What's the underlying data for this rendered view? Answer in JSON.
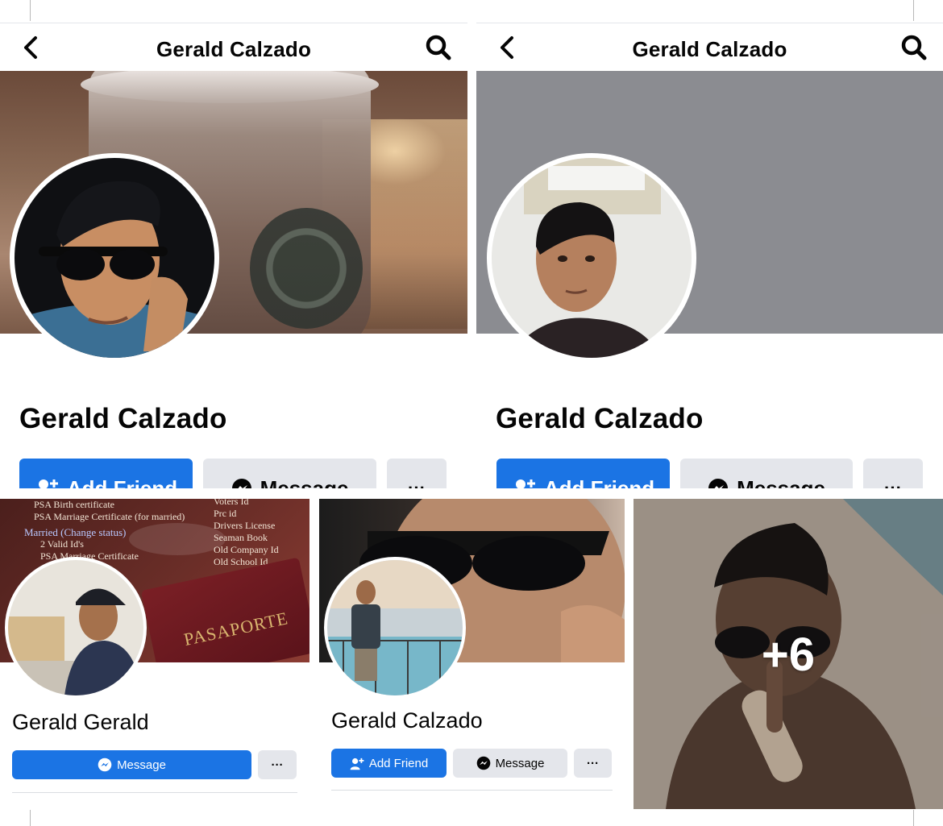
{
  "top_left": {
    "nav_title": "Gerald Calzado",
    "profile_name": "Gerald Calzado",
    "add_friend_label": "Add Friend",
    "message_label": "Message",
    "more_label": "···"
  },
  "top_right": {
    "nav_title": "Gerald Calzado",
    "profile_name": "Gerald Calzado",
    "add_friend_label": "Add Friend",
    "message_label": "Message",
    "more_label": "···"
  },
  "card_1": {
    "cover_text": {
      "col1": [
        "PSA Birth certificate",
        "PSA Marriage Certificate (for married)",
        "Married (Change status)",
        "2 Valid Id's",
        "PSA Marriage Certificate"
      ],
      "col2": [
        "Voters Id",
        "Prc id",
        "Drivers License",
        "Seaman Book",
        "Old Company Id",
        "Old School Id"
      ],
      "passport": "PASAPORTE"
    },
    "profile_name": "Gerald Gerald",
    "message_label": "Message",
    "more_label": "···"
  },
  "card_2": {
    "profile_name": "Gerald Calzado",
    "add_friend_label": "Add Friend",
    "message_label": "Message",
    "more_label": "···"
  },
  "card_3": {
    "more_count": "+6"
  },
  "colors": {
    "facebook_blue": "#1b74e4",
    "button_grey": "#e4e6eb",
    "cover_grey": "#8b8c91",
    "text": "#050505"
  },
  "icons": {
    "back": "chevron-left-icon",
    "search": "search-icon",
    "add_friend": "add-person-icon",
    "message": "messenger-icon",
    "more": "more-dots-icon"
  }
}
